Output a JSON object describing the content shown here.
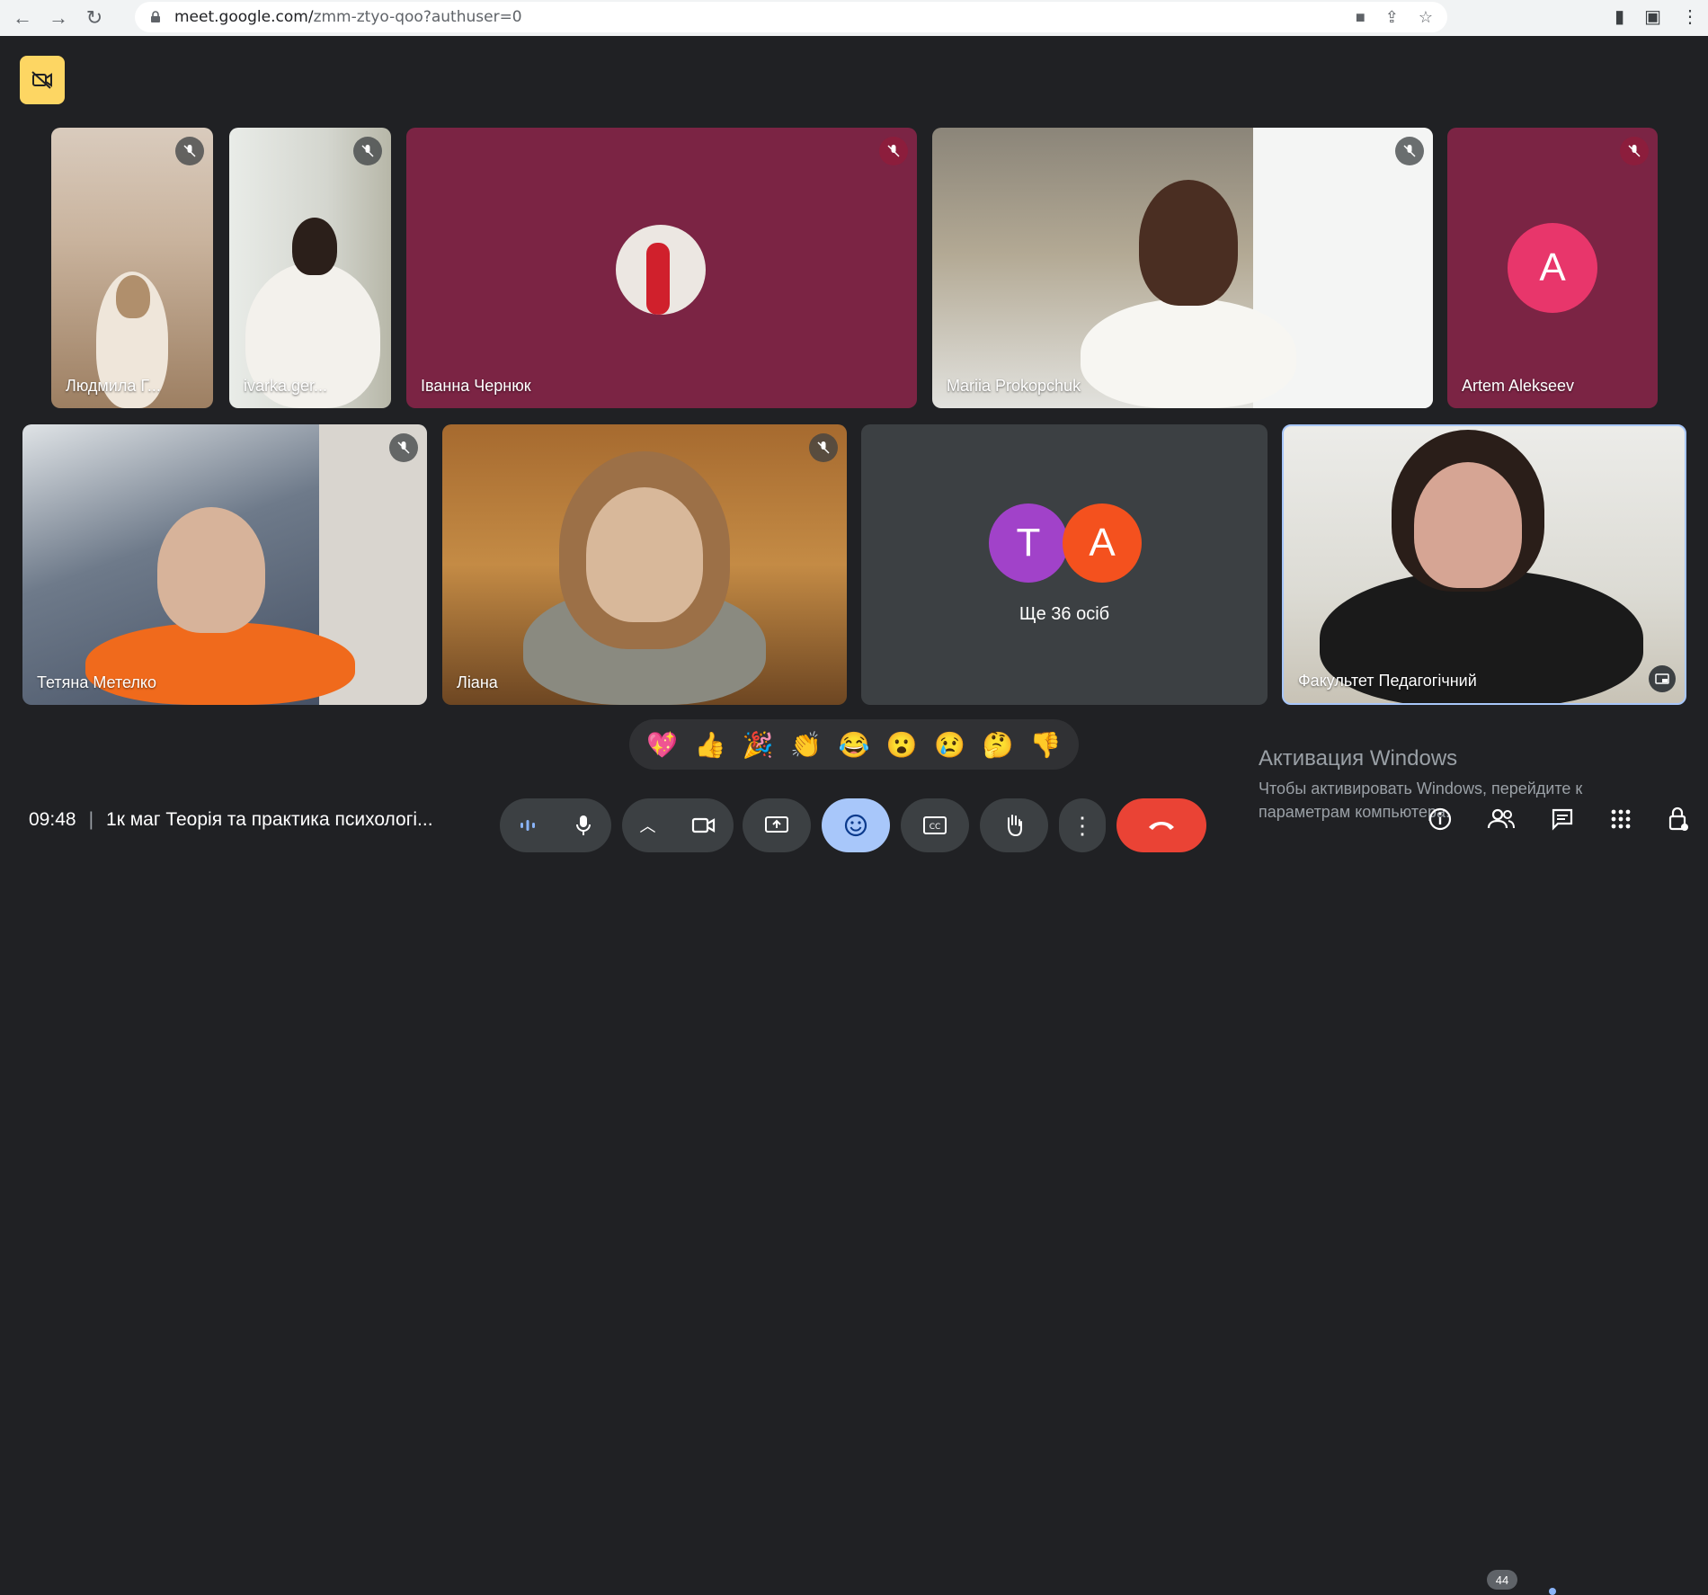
{
  "browser": {
    "url_host": "meet.google.com/",
    "url_path": "zmm-ztyo-qoo?authuser=0"
  },
  "tiles": [
    {
      "name": "Людмила Г..."
    },
    {
      "name": "ivarka.ger..."
    },
    {
      "name": "Іванна Чернюк"
    },
    {
      "name": "Mariia Prokopchuk"
    },
    {
      "name": "Artem Alekseev",
      "avatar_letter": "A"
    },
    {
      "name": "Тетяна Метелко"
    },
    {
      "name": "Ліана"
    },
    {
      "name": "Факультет Педагогічний"
    }
  ],
  "others": {
    "letters": [
      "T",
      "A"
    ],
    "label": "Ще 36 осіб"
  },
  "reactions": [
    "💖",
    "👍",
    "🎉",
    "👏",
    "😂",
    "😮",
    "😢",
    "🤔",
    "👎"
  ],
  "meeting": {
    "time": "09:48",
    "title": "1к маг Теорія та практика психологі..."
  },
  "windows_activation": {
    "line1": "Активация Windows",
    "line2": "Чтобы активировать Windows, перейдите к",
    "line3": "параметрам компьютера."
  },
  "participants_count": "44",
  "colors": {
    "maroon_tile": "#7b2444",
    "artem_avatar": "#e8366b",
    "avatar_t": "#a142c9",
    "avatar_a": "#f4511e",
    "end_call": "#ea4335",
    "active_ctrl": "#a8c7fa",
    "camera_warning": "#fdd663"
  }
}
